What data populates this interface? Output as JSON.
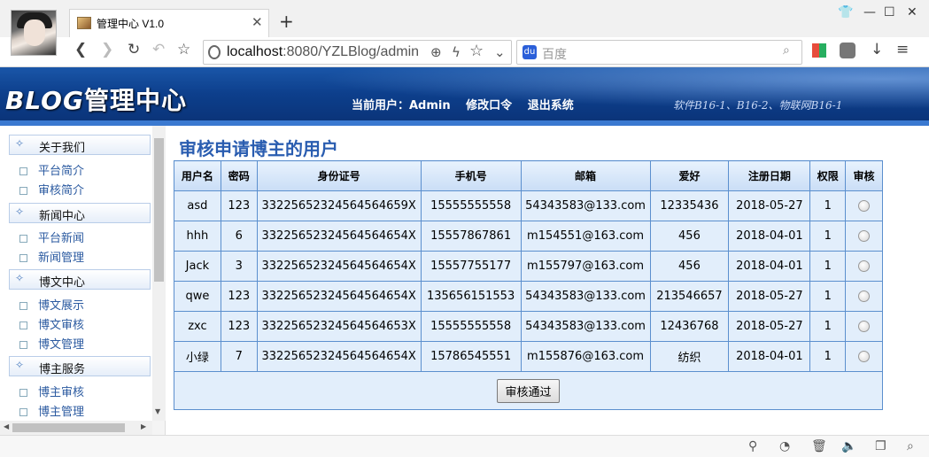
{
  "browser": {
    "tab_title": "管理中心 V1.0",
    "new_tab": "+",
    "url_host": "localhost",
    "url_rest": ":8080/YZLBlog/admin",
    "search_placeholder": "百度",
    "search_engine_glyph": "du"
  },
  "header": {
    "logo_en": "BLOG",
    "logo_cn": "管理中心",
    "current_user_label": "当前用户：Admin",
    "change_password": "修改口令",
    "logout": "退出系统",
    "slogan": "软件B16-1、B16-2、物联网B16-1"
  },
  "sidebar": {
    "sections": [
      {
        "label": "关于我们",
        "items": [
          "平台简介",
          "审核简介"
        ]
      },
      {
        "label": "新闻中心",
        "items": [
          "平台新闻",
          "新闻管理"
        ]
      },
      {
        "label": "博文中心",
        "items": [
          "博文展示",
          "博文审核",
          "博文管理"
        ]
      },
      {
        "label": "博主服务",
        "items": [
          "博主审核",
          "博主管理"
        ]
      }
    ]
  },
  "main": {
    "title": "审核申请博主的用户",
    "columns": [
      "用户名",
      "密码",
      "身份证号",
      "手机号",
      "邮箱",
      "爱好",
      "注册日期",
      "权限",
      "审核"
    ],
    "rows": [
      [
        "asd",
        "123",
        "332256523245645646​59X",
        "15555555558",
        "54343583@133.com",
        "12335436",
        "2018-05-27",
        "1"
      ],
      [
        "hhh",
        "6",
        "33225652324564564654X",
        "15557867861",
        "m154551@163.com",
        "456",
        "2018-04-01",
        "1"
      ],
      [
        "Jack",
        "3",
        "33225652324564564654X",
        "15557755177",
        "m155797@163.com",
        "456",
        "2018-04-01",
        "1"
      ],
      [
        "qwe",
        "123",
        "33225652324564564654X",
        "135656151553",
        "54343583@133.com",
        "213546657",
        "2018-05-27",
        "1"
      ],
      [
        "zxc",
        "123",
        "33225652324564564653X",
        "15555555558",
        "54343583@133.com",
        "12436768",
        "2018-05-27",
        "1"
      ],
      [
        "小绿",
        "7",
        "33225652324564564654X",
        "15786545551",
        "m155876@163.com",
        "纺织",
        "2018-04-01",
        "1"
      ]
    ],
    "approve_button": "审核通过"
  }
}
